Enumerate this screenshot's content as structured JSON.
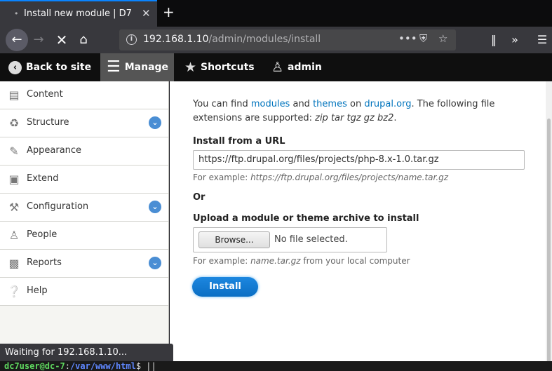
{
  "browser": {
    "tab_title": "Install new module | D7",
    "tab_close": "✕",
    "new_tab": "+",
    "url_host": "192.168.1.10",
    "url_path": "/admin/modules/install",
    "url_actions": "•••",
    "status_text": "Waiting for 192.168.1.10..."
  },
  "toolbar": {
    "back_label": "Back to site",
    "manage_label": "Manage",
    "shortcuts_label": "Shortcuts",
    "user_label": "admin"
  },
  "sidebar": {
    "items": [
      {
        "label": "Content",
        "icon": "document-icon",
        "expandable": false
      },
      {
        "label": "Structure",
        "icon": "sitemap-icon",
        "expandable": true
      },
      {
        "label": "Appearance",
        "icon": "paintbrush-icon",
        "expandable": false
      },
      {
        "label": "Extend",
        "icon": "puzzle-icon",
        "expandable": false
      },
      {
        "label": "Configuration",
        "icon": "wrench-icon",
        "expandable": true
      },
      {
        "label": "People",
        "icon": "person-icon",
        "expandable": false
      },
      {
        "label": "Reports",
        "icon": "bar-chart-icon",
        "expandable": true
      },
      {
        "label": "Help",
        "icon": "help-icon",
        "expandable": false
      }
    ]
  },
  "main": {
    "intro_prefix": "You can find ",
    "intro_link_modules": "modules",
    "intro_and": " and ",
    "intro_link_themes": "themes",
    "intro_on": " on ",
    "intro_link_drupal": "drupal.org",
    "intro_rest": ". The following file extensions are supported: ",
    "intro_extensions": "zip tar tgz gz bz2",
    "intro_end": ".",
    "url_label": "Install from a URL",
    "url_value": "https://ftp.drupal.org/files/projects/php-8.x-1.0.tar.gz",
    "url_example_prefix": "For example: ",
    "url_example": "https://ftp.drupal.org/files/projects/name.tar.gz",
    "or_label": "Or",
    "upload_label": "Upload a module or theme archive to install",
    "browse_label": "Browse...",
    "no_file_text": "No file selected.",
    "upload_example_prefix": "For example: ",
    "upload_example": "name.tar.gz",
    "upload_example_suffix": " from your local computer",
    "install_label": "Install"
  },
  "terminal": {
    "user_host": "dc7user@dc-7",
    "sep": ":",
    "path": "/var/www/html",
    "prompt": "$ ||"
  },
  "colors": {
    "accent": "#0a84ff",
    "link": "#0074bd",
    "install_button": "#1d87e0",
    "toolbar_bg": "#0f0f0f"
  }
}
